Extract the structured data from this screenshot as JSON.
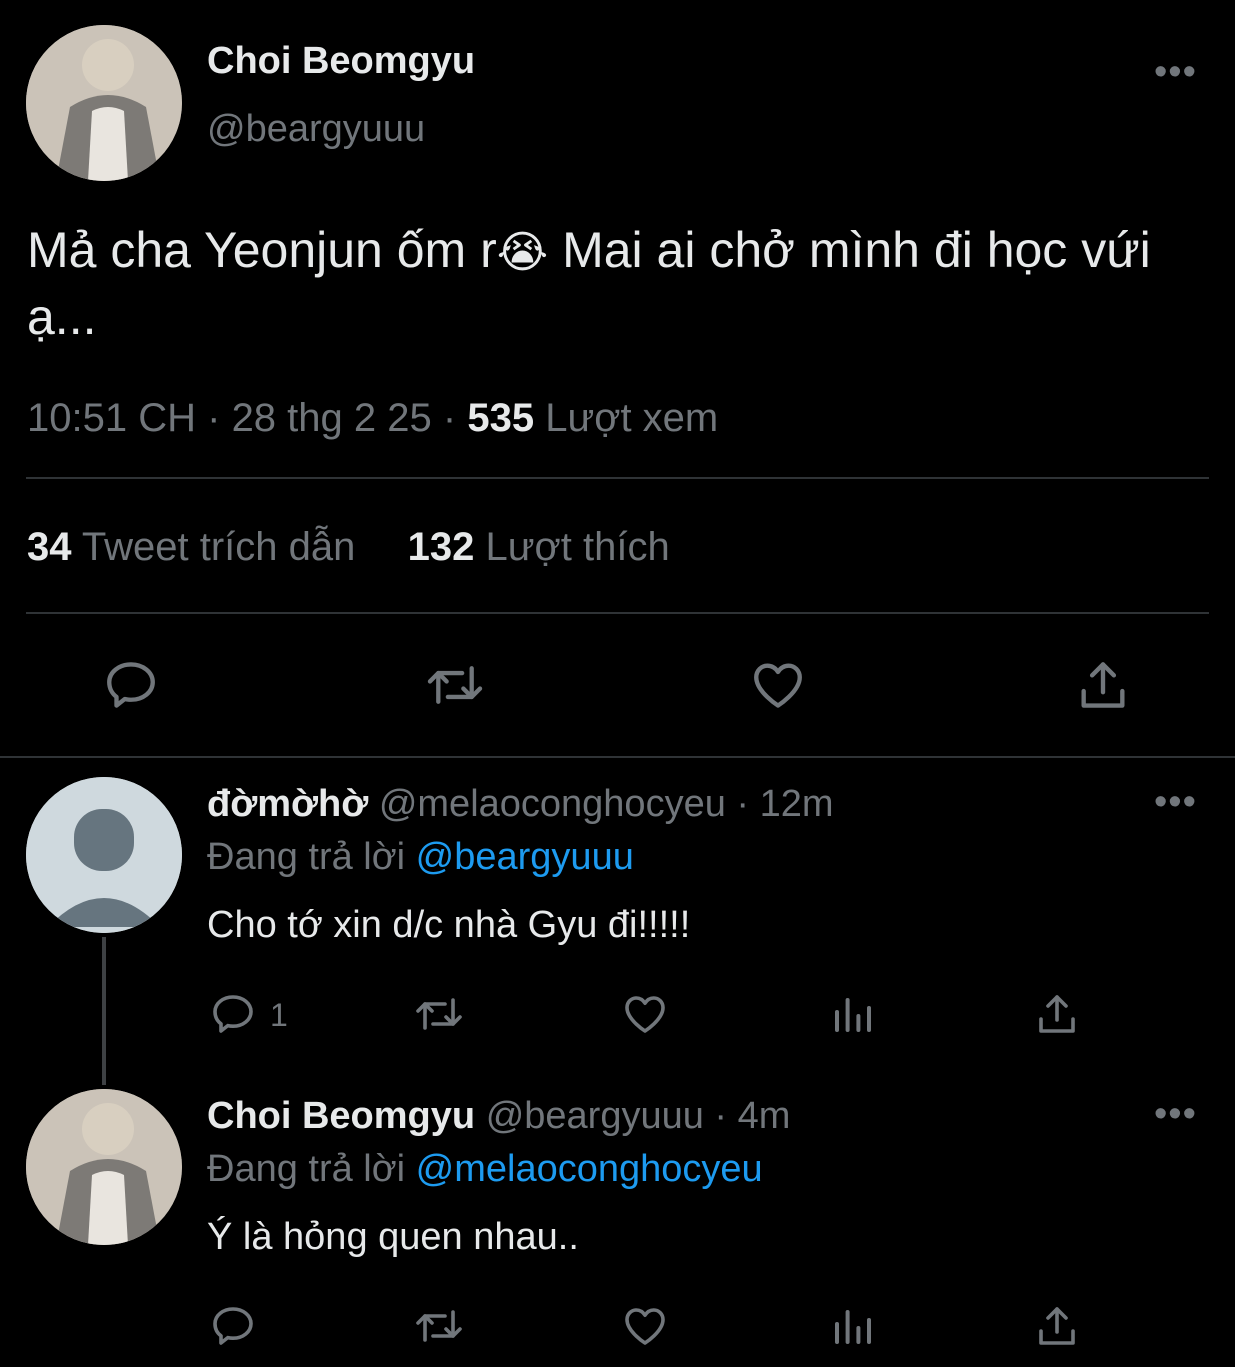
{
  "main_tweet": {
    "author_name": "Choi Beomgyu",
    "author_handle": "@beargyuuu",
    "text_part1": "Mả cha Yeonjun ốm r",
    "emoji": "😭",
    "text_part2": " Mai ai chở mình đi học vứi ạ...",
    "time": "10:51 CH",
    "sep1": "·",
    "date": "28 thg 2 25",
    "sep2": "·",
    "views": "535",
    "views_label": "Lượt xem",
    "quote_count": "34",
    "quote_label": "Tweet trích dẫn",
    "like_count": "132",
    "like_label": "Lượt thích",
    "more_icon": "more-icon"
  },
  "reply1": {
    "author_name": "đờmờhờ",
    "author_handle": "@melaoconghocyeu",
    "time": "· 12m",
    "replying_label": "Đang trả lời",
    "replying_to": "@beargyuuu",
    "text": "Cho tớ xin d/c nhà Gyu đi!!!!!",
    "reply_count": "1"
  },
  "reply2": {
    "author_name": "Choi Beomgyu",
    "author_handle": "@beargyuuu",
    "time": "· 4m",
    "replying_label": "Đang trả lời",
    "replying_to": "@melaoconghocyeu",
    "text": "Ý là hỏng quen nhau.."
  },
  "colors": {
    "background": "#000000",
    "text": "#e7e9ea",
    "muted": "#71767b",
    "link": "#1d9bf0",
    "divider": "#2f3336"
  }
}
